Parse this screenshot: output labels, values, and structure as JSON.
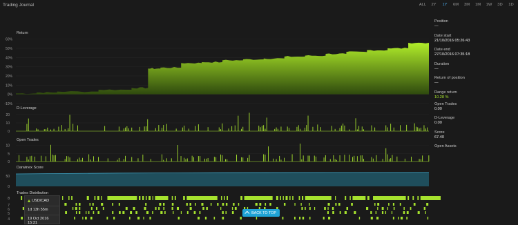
{
  "app": {
    "title": "Trading Journal"
  },
  "ranges": [
    {
      "label": "ALL",
      "active": false
    },
    {
      "label": "2Y",
      "active": false
    },
    {
      "label": "1Y",
      "active": true
    },
    {
      "label": "6M",
      "active": false
    },
    {
      "label": "3M",
      "active": false
    },
    {
      "label": "1M",
      "active": false
    },
    {
      "label": "1W",
      "active": false
    },
    {
      "label": "3D",
      "active": false
    },
    {
      "label": "1D",
      "active": false
    }
  ],
  "panels": {
    "return_label": "Return",
    "return_ticks": [
      "60%",
      "50%",
      "40%",
      "30%",
      "20%",
      "10%",
      "0%",
      "-10%"
    ],
    "dleverage_label": "D-Leverage",
    "dleverage_ticks": [
      "20",
      "10",
      "0"
    ],
    "opentrades_label": "Open Trades",
    "opentrades_ticks": [
      "10",
      "5",
      "0"
    ],
    "score_label": "Darwinex Score",
    "score_ticks": [
      "50",
      "0"
    ],
    "dist_label": "Trades Distribution",
    "dist_ticks": [
      "8",
      "7",
      "6",
      "5",
      "4"
    ]
  },
  "side": {
    "position_label": "Position",
    "position_value": "—",
    "date_start_label": "Date start",
    "date_start_value": "21/10/2016 05:26:43",
    "date_end_label": "Date end",
    "date_end_value": "27/10/2016 07:35:18",
    "duration_label": "Duration",
    "duration_value": "—",
    "return_pos_label": "Return of position",
    "return_pos_value": "—",
    "range_return_label": "Range return",
    "range_return_value": "10.28 %",
    "open_trades_label": "Open Trades",
    "open_trades_value": "0.00",
    "dleverage_label": "D-Leverage",
    "dleverage_value": "0.00",
    "score_label": "Score",
    "score_value": "67.40",
    "open_assets_label": "Open Assets"
  },
  "tooltip": {
    "symbol": "USD/CAD",
    "duration": "1d 13h 55m",
    "date": "19 Oct 2016 15:31"
  },
  "back_to_top": "BACK TO TOP",
  "colors": {
    "accent": "#a6e22e",
    "score_fill": "#1f4e5c",
    "score_line": "#3fa0c0",
    "link": "#4aa8e8",
    "button": "#1fa3d6"
  },
  "chart_data": [
    {
      "type": "area",
      "title": "Return",
      "ylabel": "",
      "ylim": [
        -10,
        65
      ],
      "x": [
        0,
        5,
        10,
        20,
        28,
        32,
        35,
        40,
        45,
        50,
        55,
        60,
        65,
        70,
        75,
        80,
        85,
        90,
        95,
        100
      ],
      "values": [
        1,
        2,
        3,
        5,
        7,
        28,
        29,
        34,
        35,
        37,
        38,
        39,
        41,
        42,
        44,
        46,
        48,
        50,
        56,
        57
      ]
    },
    {
      "type": "bar",
      "title": "D-Leverage",
      "ylim": [
        0,
        25
      ],
      "note_values": "spiky series peaking near 20"
    },
    {
      "type": "bar",
      "title": "Open Trades",
      "ylim": [
        0,
        12
      ],
      "note_values": "spiky series peaking near 10"
    },
    {
      "type": "area",
      "title": "Darwinex Score",
      "ylim": [
        0,
        80
      ],
      "x": [
        0,
        25,
        50,
        75,
        100
      ],
      "values": [
        60,
        64,
        66,
        67,
        67.4
      ]
    }
  ]
}
